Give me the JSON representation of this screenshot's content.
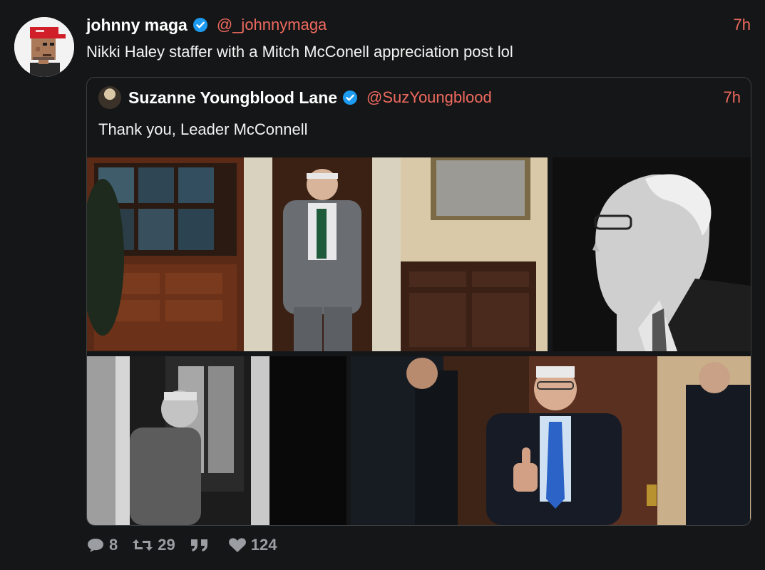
{
  "tweet": {
    "author_name": "johnny maga",
    "author_handle": "@_johnnymaga",
    "time": "7h",
    "text": "Nikki Haley staffer with a Mitch McConell appreciation post lol"
  },
  "quote": {
    "author_name": "Suzanne Youngblood Lane",
    "author_handle": "@SuzYoungblood",
    "time": "7h",
    "text": "Thank you, Leader McConnell"
  },
  "actions": {
    "replies": "8",
    "retweets": "29",
    "quotes_icon": "quote-icon",
    "likes": "124"
  },
  "colors": {
    "accent": "#ef6a5f",
    "verified": "#1d9bf0",
    "background": "#151617"
  }
}
